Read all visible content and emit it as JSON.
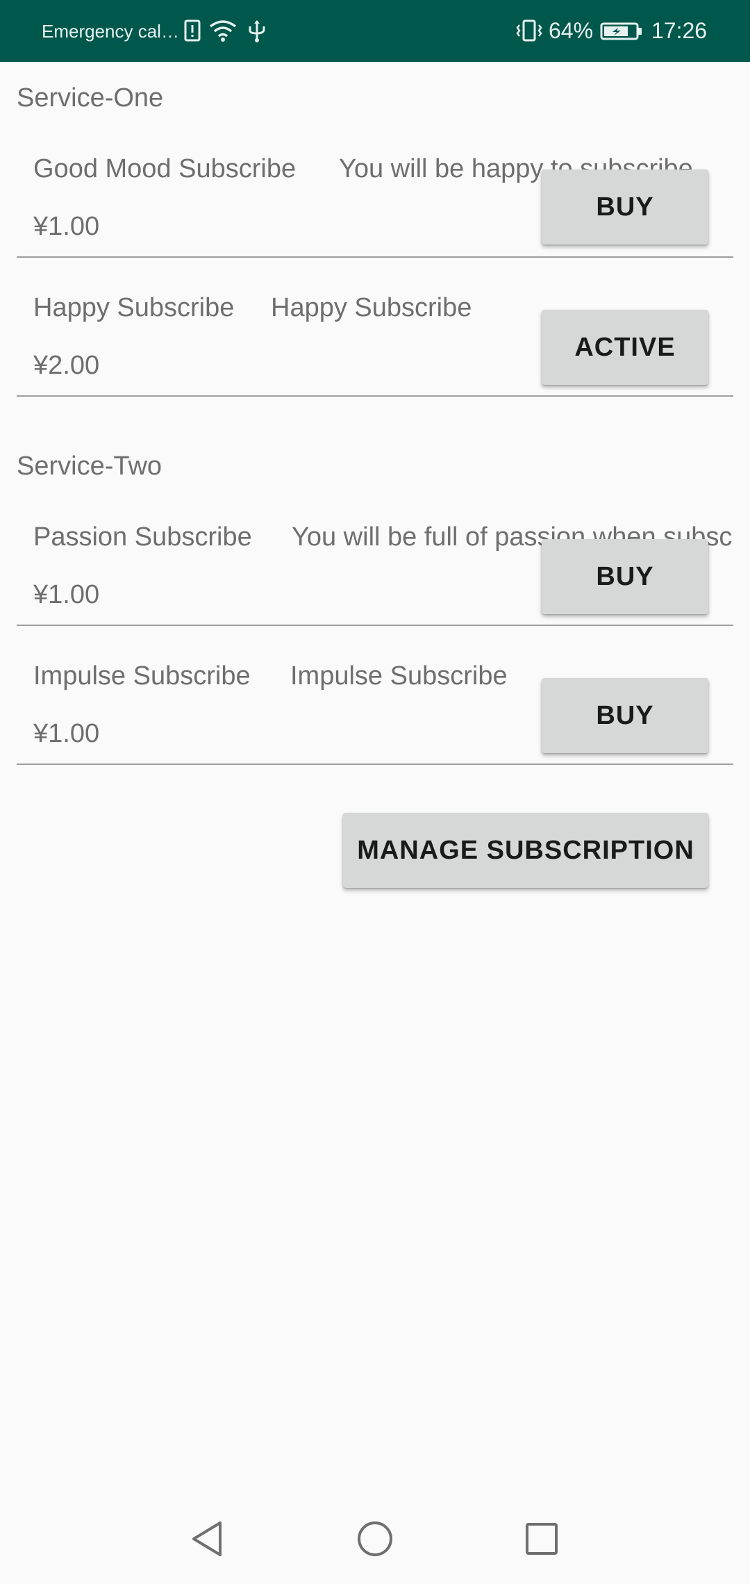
{
  "status_bar": {
    "carrier": "Emergency cal…",
    "battery_percent": "64%",
    "time": "17:26",
    "icons": [
      "sim-alert-icon",
      "wifi-icon",
      "usb-icon",
      "vibrate-icon",
      "battery-icon"
    ]
  },
  "sections": [
    {
      "title": "Service-One",
      "products": [
        {
          "name": "Good Mood Subscribe",
          "description": "You will be happy to subscribe",
          "price": "¥1.00",
          "button": "BUY"
        },
        {
          "name": "Happy Subscribe",
          "description": "Happy Subscribe",
          "price": "¥2.00",
          "button": "ACTIVE"
        }
      ]
    },
    {
      "title": "Service-Two",
      "products": [
        {
          "name": "Passion Subscribe",
          "description": "You will be full of passion when subscribe",
          "price": "¥1.00",
          "button": "BUY"
        },
        {
          "name": "Impulse Subscribe",
          "description": "Impulse Subscribe",
          "price": "¥1.00",
          "button": "BUY"
        }
      ]
    }
  ],
  "manage_button": "MANAGE SUBSCRIPTION",
  "nav_bar": {
    "icons": [
      "back-icon",
      "home-icon",
      "recents-icon"
    ]
  },
  "colors": {
    "status_bar": "#00574b",
    "background": "#fafafa",
    "button": "#d6d7d7",
    "text": "#6e6e6e"
  }
}
